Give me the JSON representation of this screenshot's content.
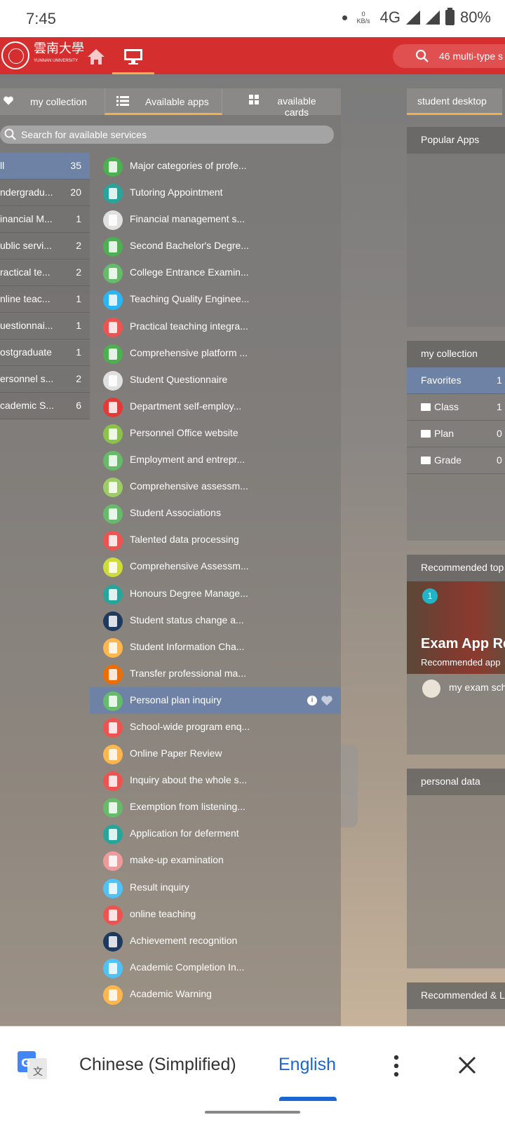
{
  "status": {
    "time": "7:45",
    "kbs_num": "0",
    "kbs_unit": "KB/s",
    "network": "4G",
    "battery": "80%"
  },
  "header": {
    "logo_text": "雲南大學",
    "logo_sub": "YUNNAN UNIVERSITY",
    "search_placeholder": "46 multi-type s"
  },
  "tabs": {
    "collection": "my collection",
    "available_apps": "Available apps",
    "available_cards": "available cards"
  },
  "search": {
    "placeholder": "Search for available services"
  },
  "categories": [
    {
      "name": "ll",
      "count": "35"
    },
    {
      "name": "ndergradu...",
      "count": "20"
    },
    {
      "name": "inancial M...",
      "count": "1"
    },
    {
      "name": "ublic servi...",
      "count": "2"
    },
    {
      "name": "ractical te...",
      "count": "2"
    },
    {
      "name": "nline teac...",
      "count": "1"
    },
    {
      "name": "uestionnai...",
      "count": "1"
    },
    {
      "name": "ostgraduate",
      "count": "1"
    },
    {
      "name": "ersonnel s...",
      "count": "2"
    },
    {
      "name": "cademic S...",
      "count": "6"
    }
  ],
  "apps": [
    {
      "label": "Major categories of profe...",
      "icon": "graduate-icon",
      "color": "#4caf50"
    },
    {
      "label": "Tutoring Appointment",
      "icon": "teacher-icon",
      "color": "#26a69a"
    },
    {
      "label": "Financial management s...",
      "icon": "image-placeholder-icon",
      "color": "#e0e0e0"
    },
    {
      "label": "Second Bachelor's Degre...",
      "icon": "graduate-icon",
      "color": "#4caf50"
    },
    {
      "label": "College Entrance Examin...",
      "icon": "document-icon",
      "color": "#66bb6a"
    },
    {
      "label": "Teaching Quality Enginee...",
      "icon": "document-icon",
      "color": "#29b6f6"
    },
    {
      "label": "Practical teaching integra...",
      "icon": "presentation-icon",
      "color": "#ef5350"
    },
    {
      "label": "Comprehensive platform ...",
      "icon": "graduate-icon",
      "color": "#4caf50"
    },
    {
      "label": "Student Questionnaire",
      "icon": "image-placeholder-icon",
      "color": "#e0e0e0"
    },
    {
      "label": "Department self-employ...",
      "icon": "worker-icon",
      "color": "#e53935"
    },
    {
      "label": "Personnel Office website",
      "icon": "id-card-icon",
      "color": "#8bc34a"
    },
    {
      "label": "Employment and entrepr...",
      "icon": "people-icon",
      "color": "#66bb6a"
    },
    {
      "label": "Comprehensive assessm...",
      "icon": "clipboard-icon",
      "color": "#9ccc65"
    },
    {
      "label": "Student Associations",
      "icon": "people-icon",
      "color": "#66bb6a"
    },
    {
      "label": "Talented data processing",
      "icon": "printer-icon",
      "color": "#ef5350"
    },
    {
      "label": "Comprehensive Assessm...",
      "icon": "clipboard-icon",
      "color": "#cddc39"
    },
    {
      "label": "Honours Degree Manage...",
      "icon": "teacher-icon",
      "color": "#26a69a"
    },
    {
      "label": "Student status change a...",
      "icon": "document-icon",
      "color": "#1e3a5f"
    },
    {
      "label": "Student Information Cha...",
      "icon": "id-card-icon",
      "color": "#ffb74d"
    },
    {
      "label": "Transfer professional ma...",
      "icon": "transfer-icon",
      "color": "#ef6c00"
    },
    {
      "label": "Personal plan inquiry",
      "icon": "search-document-icon",
      "color": "#66bb6a"
    },
    {
      "label": "School-wide program enq...",
      "icon": "search-document-icon",
      "color": "#ef5350"
    },
    {
      "label": "Online Paper Review",
      "icon": "search-document-icon",
      "color": "#ffb74d"
    },
    {
      "label": "Inquiry about the whole s...",
      "icon": "calendar-icon",
      "color": "#ef5350"
    },
    {
      "label": "Exemption from listening...",
      "icon": "document-icon",
      "color": "#66bb6a"
    },
    {
      "label": "Application for deferment",
      "icon": "tablet-icon",
      "color": "#26a69a"
    },
    {
      "label": "make-up examination",
      "icon": "exam-icon",
      "color": "#ef9a9a"
    },
    {
      "label": "Result inquiry",
      "icon": "search-icon",
      "color": "#4fc3f7"
    },
    {
      "label": "online teaching",
      "icon": "monitor-icon",
      "color": "#ef5350"
    },
    {
      "label": "Achievement recognition",
      "icon": "book-icon",
      "color": "#1e3a5f"
    },
    {
      "label": "Academic Completion In...",
      "icon": "award-icon",
      "color": "#4fc3f7"
    },
    {
      "label": "Academic Warning",
      "icon": "warning-icon",
      "color": "#ffb74d"
    }
  ],
  "selected_app_index": 20,
  "info_glyph": "i",
  "right": {
    "tab": "student desktop",
    "popular": "Popular Apps",
    "collection": "my collection",
    "collection_rows": [
      {
        "name": "Favorites",
        "count": "1"
      },
      {
        "name": "Class",
        "count": "1"
      },
      {
        "name": "Plan",
        "count": "0"
      },
      {
        "name": "Grade",
        "count": "0"
      }
    ],
    "recommended": "Recommended top",
    "rec_num": "1",
    "rec_title": "Exam App Rec",
    "rec_sub": "Recommended app",
    "rec_item": "my exam sch",
    "personal": "personal data",
    "rec_latest": "Recommended & L"
  },
  "translate": {
    "source": "Chinese (Simplified)",
    "target": "English"
  }
}
